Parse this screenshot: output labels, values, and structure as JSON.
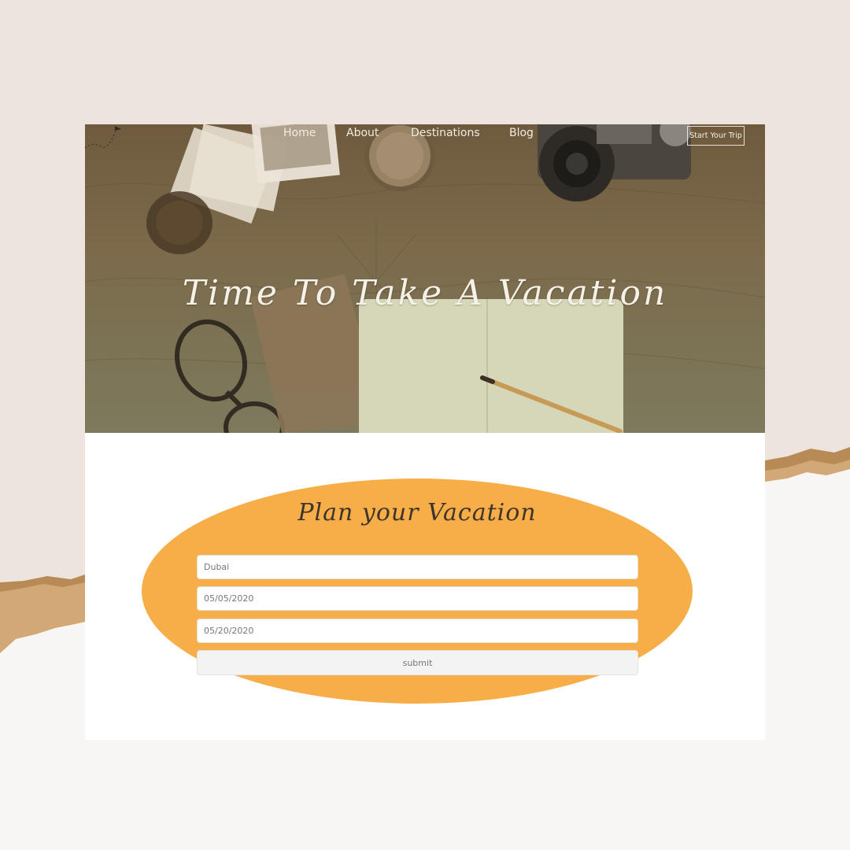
{
  "nav": {
    "items": [
      "Home",
      "About",
      "Destinations",
      "Blog"
    ],
    "cta_label": "Start Your Trip"
  },
  "hero": {
    "title": "Time To Take A Vacation"
  },
  "form": {
    "title": "Plan your Vacation",
    "destination_value": "Dubai",
    "start_date_value": "05/05/2020",
    "end_date_value": "05/20/2020",
    "submit_label": "submit"
  },
  "colors": {
    "background": "#ede4de",
    "form_accent": "#f8ae48",
    "hero_tint": "#7c6a4b"
  },
  "icons": [
    "airplane-icon",
    "camera-icon",
    "magnifying-glass-icon",
    "eyeglasses-icon",
    "pencil-icon"
  ]
}
